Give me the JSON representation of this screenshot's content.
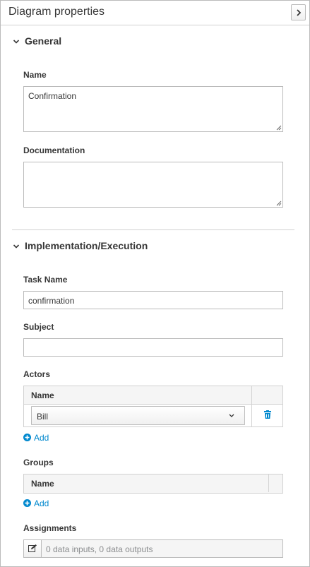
{
  "header": {
    "title": "Diagram properties",
    "collapse_icon": "chevron-right-icon"
  },
  "general": {
    "title": "General",
    "name": {
      "label": "Name",
      "value": "Confirmation"
    },
    "documentation": {
      "label": "Documentation",
      "value": ""
    }
  },
  "implementation": {
    "title": "Implementation/Execution",
    "task_name": {
      "label": "Task Name",
      "value": "confirmation"
    },
    "subject": {
      "label": "Subject",
      "value": ""
    },
    "actors": {
      "label": "Actors",
      "column": "Name",
      "rows": [
        {
          "value": "Bill"
        }
      ],
      "add_label": "Add"
    },
    "groups": {
      "label": "Groups",
      "column": "Name",
      "add_label": "Add"
    },
    "assignments": {
      "label": "Assignments",
      "value": "0 data inputs, 0 data outputs"
    }
  },
  "colors": {
    "accent": "#0088ce",
    "text": "#363636",
    "border": "#bbbbbb"
  }
}
